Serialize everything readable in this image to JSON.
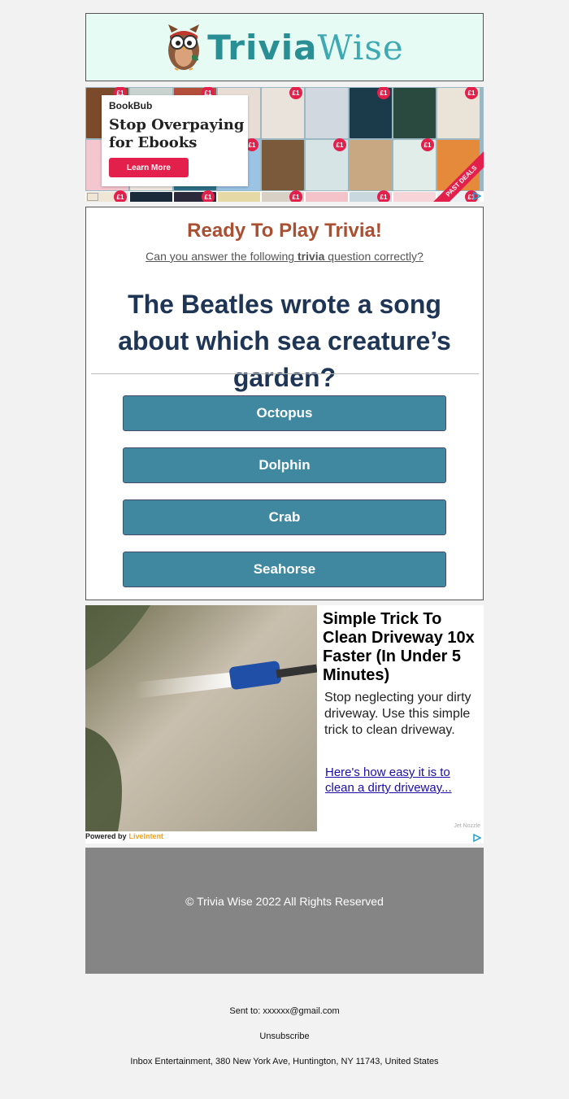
{
  "header": {
    "logo_text_a": "Trivia",
    "logo_text_b": "Wise"
  },
  "ad_bookbub": {
    "brand": "BookBub",
    "headline": "Stop Overpaying for Ebooks",
    "cta": "Learn More",
    "ribbon": "PAST DEALS",
    "badge": "£1",
    "book_colors": [
      "#7a4a2a",
      "#c9d3cf",
      "#b24e3a",
      "#e8ddd4",
      "#e9e3dc",
      "#d2d8e0",
      "#1b3a4a",
      "#2b4a3f",
      "#eae3d8",
      "#f4c6cf",
      "#eee8e0",
      "#2c6f84",
      "#9ac3e4",
      "#7a5a3a",
      "#d7e4e6",
      "#c7a882",
      "#e1ede9",
      "#e58a3a",
      "#f0e6d6",
      "#1a2a3a",
      "#2a2a3a",
      "#e5d9a5",
      "#d9d0c5",
      "#f4c2c9",
      "#c9d7df",
      "#f6d4d8",
      "#e8eef2"
    ]
  },
  "trivia": {
    "title": "Ready To Play Trivia!",
    "subtitle_a": "Can you answer the following ",
    "subtitle_b": "trivia",
    "subtitle_c": " question correctly?",
    "question": "The Beatles wrote a song about which sea creature’s garden?",
    "answers": [
      "Octopus",
      "Dolphin",
      "Crab",
      "Seahorse"
    ]
  },
  "ad_driveway": {
    "headline": "Simple Trick To Clean Driveway 10x Faster (In Under 5 Minutes)",
    "body": "Stop neglecting your dirty driveway. Use this simple trick to clean driveway.",
    "link": "Here's how easy it is to clean a dirty driveway...",
    "credit": "Jet Nozzle",
    "powered_by": "Powered by",
    "network": "LiveIntent"
  },
  "footer": {
    "copyright": "© Trivia Wise 2022 All Rights Reserved",
    "sent_to": "Sent to: xxxxxx@gmail.com",
    "unsubscribe": "Unsubscribe",
    "address": "Inbox Entertainment, 380 New York Ave, Huntington, NY 11743, United States"
  },
  "colors": {
    "title": "#a94f32",
    "question": "#1f3555",
    "answer_bg": "#3f88a0",
    "footer_bg": "#858585"
  }
}
